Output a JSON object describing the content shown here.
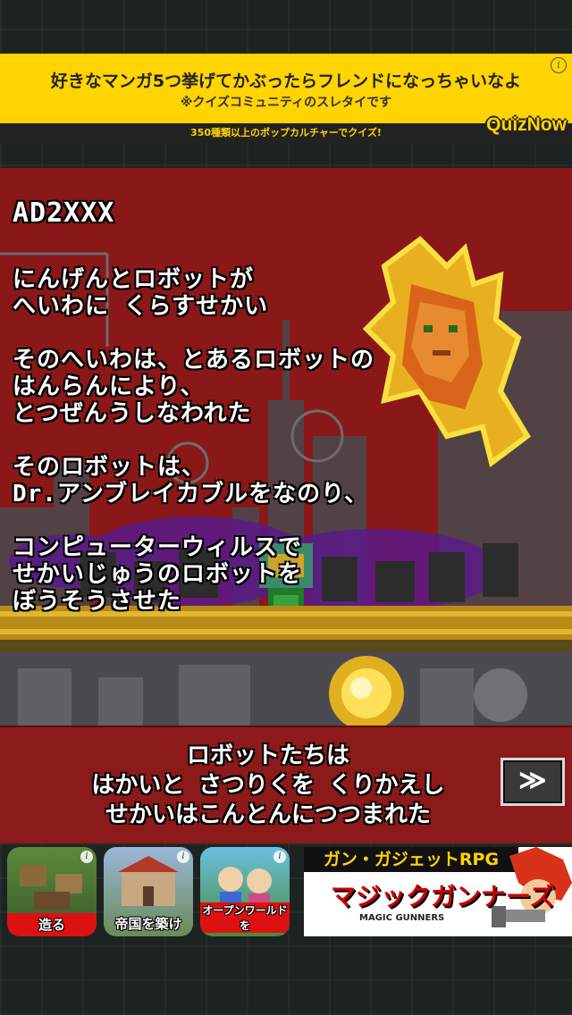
{
  "ad_top": {
    "headline": "好きなマンガ5つ挙げてかぶったらフレンドになっちゃいなよ",
    "subline": "※クイズコミュニティのスレタイです",
    "strip": "350種類以上のポップカルチャーでクイズ!",
    "brand": "QuizNow",
    "info_icon": "i"
  },
  "story": {
    "title": "AD2XXX",
    "paragraphs": [
      "にんげんとロボットが\nへいわに くらすせかい",
      "そのへいわは、とあるロボットの\nはんらんにより、\nとつぜんうしなわれた",
      "そのロボットは、\nDr.アンブレイカブルをなのり、",
      "コンピューターウィルスで\nせかいじゅうのロボットを\nぼうそうさせた"
    ]
  },
  "dialog": {
    "text": "ロボットたちは\nはかいと さつりくを くりかえし\nせかいはこんとんにつつまれた",
    "skip_label": "≫"
  },
  "ad_bottom": {
    "tiles": [
      {
        "caption": "造る",
        "info": "i"
      },
      {
        "caption": "帝国を築け",
        "info": "i"
      },
      {
        "caption": "オープンワールドを",
        "info": "i"
      }
    ],
    "banner": {
      "title": "ガン・ガジェットRPG",
      "logo": "マジックガンナーズ",
      "logo_sub": "MAGIC GUNNERS"
    }
  },
  "colors": {
    "ad_yellow": "#ffd400",
    "story_red": "#8a1818",
    "dialog_red": "#8c1a1a"
  }
}
